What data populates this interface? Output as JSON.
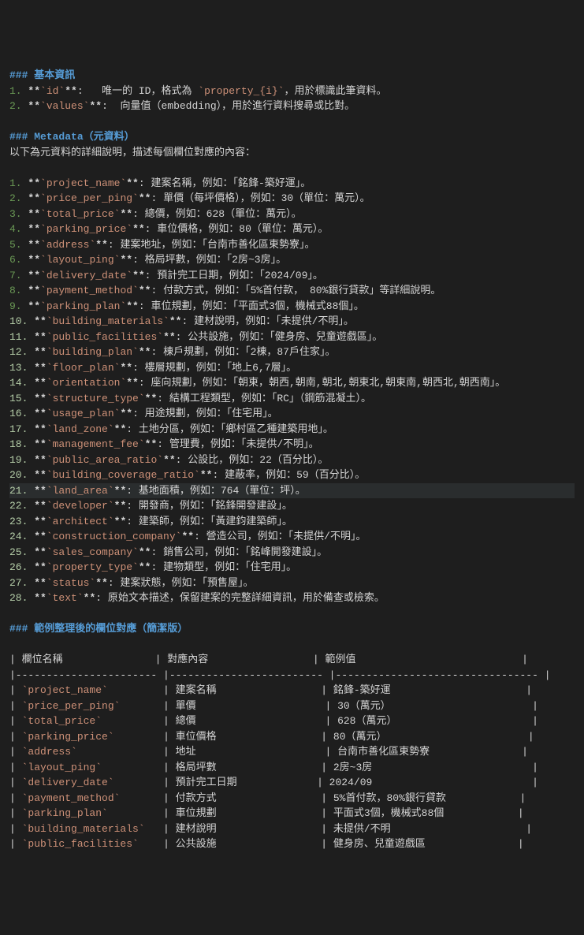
{
  "section1": {
    "title": "### 基本資訊",
    "items": [
      {
        "num": "1.",
        "field": "**`id`**",
        "desc": ":   唯一的 ID，格式為 ",
        "code": "`property_{i}`",
        "suffix": "，用於標識此筆資料。"
      },
      {
        "num": "2.",
        "field": "**`values`**",
        "desc": ":  向量值（embedding），用於進行資料搜尋或比對。"
      }
    ]
  },
  "section2": {
    "title": "### Metadata（元資料）",
    "intro": "以下為元資料的詳細說明，描述每個欄位對應的內容：",
    "items": [
      {
        "num": "1.",
        "field": "**`project_name`**",
        "desc": ": 建案名稱，例如：「銘鋒-築好運」。"
      },
      {
        "num": "2.",
        "field": "**`price_per_ping`**",
        "desc": ": 單價（每坪價格），例如：30（單位：萬元）。"
      },
      {
        "num": "3.",
        "field": "**`total_price`**",
        "desc": ": 總價，例如：628（單位：萬元）。"
      },
      {
        "num": "4.",
        "field": "**`parking_price`**",
        "desc": ": 車位價格，例如：80（單位：萬元）。"
      },
      {
        "num": "5.",
        "field": "**`address`**",
        "desc": ": 建案地址，例如：「台南市善化區東勢寮」。"
      },
      {
        "num": "6.",
        "field": "**`layout_ping`**",
        "desc": ": 格局坪數，例如：「2房~3房」。"
      },
      {
        "num": "7.",
        "field": "**`delivery_date`**",
        "desc": ": 預計完工日期，例如：「2024/09」。"
      },
      {
        "num": "8.",
        "field": "**`payment_method`**",
        "desc": ": 付款方式，例如：「5%首付款， 80%銀行貸款」等詳細說明。"
      },
      {
        "num": "9.",
        "field": "**`parking_plan`**",
        "desc": ": 車位規劃，例如：「平面式3個，機械式88個」。"
      },
      {
        "num": "10.",
        "field": "**`building_materials`**",
        "desc": ": 建材說明，例如：「未提供/不明」。"
      },
      {
        "num": "11.",
        "field": "**`public_facilities`**",
        "desc": ": 公共設施，例如：「健身房、兒童遊戲區」。"
      },
      {
        "num": "12.",
        "field": "**`building_plan`**",
        "desc": ": 棟戶規劃，例如：「2棟，87戶住家」。"
      },
      {
        "num": "13.",
        "field": "**`floor_plan`**",
        "desc": ": 樓層規劃，例如：「地上6,7層」。"
      },
      {
        "num": "14.",
        "field": "**`orientation`**",
        "desc": ": 座向規劃，例如：「朝東，朝西,朝南,朝北,朝東北,朝東南,朝西北,朝西南」。"
      },
      {
        "num": "15.",
        "field": "**`structure_type`**",
        "desc": ": 結構工程類型，例如：「RC」（鋼筋混凝土）。"
      },
      {
        "num": "16.",
        "field": "**`usage_plan`**",
        "desc": ": 用途規劃，例如：「住宅用」。"
      },
      {
        "num": "17.",
        "field": "**`land_zone`**",
        "desc": ": 土地分區，例如：「鄉村區乙種建築用地」。"
      },
      {
        "num": "18.",
        "field": "**`management_fee`**",
        "desc": ": 管理費，例如：「未提供/不明」。"
      },
      {
        "num": "19.",
        "field": "**`public_area_ratio`**",
        "desc": ": 公設比，例如：22（百分比）。"
      },
      {
        "num": "20.",
        "field": "**`building_coverage_ratio`**",
        "desc": ": 建蔽率，例如：59（百分比）。"
      },
      {
        "num": "21.",
        "field": "**`land_area`**",
        "desc": ": 基地面積，例如：764（單位：坪）。",
        "hl": true
      },
      {
        "num": "22.",
        "field": "**`developer`**",
        "desc": ": 開發商，例如：「銘鋒開發建設」。"
      },
      {
        "num": "23.",
        "field": "**`architect`**",
        "desc": ": 建築師，例如：「黃建鈞建築師」。"
      },
      {
        "num": "24.",
        "field": "**`construction_company`**",
        "desc": ": 營造公司，例如：「未提供/不明」。"
      },
      {
        "num": "25.",
        "field": "**`sales_company`**",
        "desc": ": 銷售公司，例如：「銘峰開發建設」。"
      },
      {
        "num": "26.",
        "field": "**`property_type`**",
        "desc": ": 建物類型，例如：「住宅用」。"
      },
      {
        "num": "27.",
        "field": "**`status`**",
        "desc": ": 建案狀態，例如：「預售屋」。"
      },
      {
        "num": "28.",
        "field": "**`text`**",
        "desc": ": 原始文本描述，保留建案的完整詳細資訊，用於備查或檢索。"
      }
    ]
  },
  "section3": {
    "title": "### 範例整理後的欄位對應（簡潔版）",
    "header": {
      "c1": "欄位名稱",
      "c2": "對應內容",
      "c3": "範例值"
    },
    "sep": {
      "c1": "-----------------------",
      "c2": "-------------------------",
      "c3": "---------------------------------"
    },
    "rows": [
      {
        "c1": "`project_name`",
        "c2": "建案名稱",
        "c3": "銘鋒-築好運"
      },
      {
        "c1": "`price_per_ping`",
        "c2": "單價",
        "c3": "30（萬元）"
      },
      {
        "c1": "`total_price`",
        "c2": "總價",
        "c3": "628（萬元）"
      },
      {
        "c1": "`parking_price`",
        "c2": "車位價格",
        "c3": "80（萬元）"
      },
      {
        "c1": "`address`",
        "c2": "地址",
        "c3": "台南市善化區東勢寮"
      },
      {
        "c1": "`layout_ping`",
        "c2": "格局坪數",
        "c3": "2房~3房"
      },
      {
        "c1": "`delivery_date`",
        "c2": "預計完工日期",
        "c3": "2024/09"
      },
      {
        "c1": "`payment_method`",
        "c2": "付款方式",
        "c3": "5%首付款，80%銀行貸款"
      },
      {
        "c1": "`parking_plan`",
        "c2": "車位規劃",
        "c3": "平面式3個，機械式88個"
      },
      {
        "c1": "`building_materials`",
        "c2": "建材說明",
        "c3": "未提供/不明"
      },
      {
        "c1": "`public_facilities`",
        "c2": "公共設施",
        "c3": "健身房、兒童遊戲區"
      }
    ]
  }
}
